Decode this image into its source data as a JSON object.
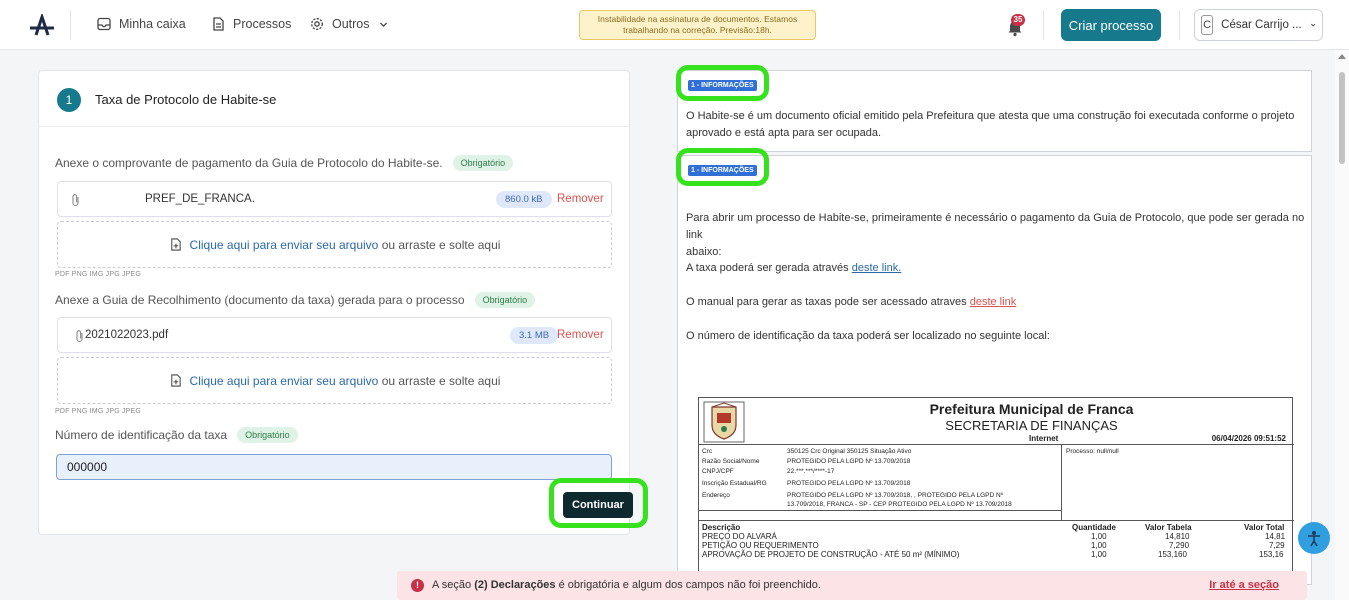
{
  "nav": {
    "inbox_label": "Minha caixa",
    "processes_label": "Processos",
    "others_label": "Outros",
    "notice": "Instabilidade na assinatura de documentos. Estamos trabalhando na correção. Previsão:18h.",
    "notification_count": "35",
    "create_button": "Criar processo",
    "user_initial": "C",
    "user_name": "César Carrijo ..."
  },
  "form": {
    "step_number": "1",
    "step_title": "Taxa de Protocolo de Habite-se",
    "required_badge": "Obrigatório",
    "field1_label": "Anexe o comprovante de pagamento da Guia de Protocolo do Habite-se.",
    "file1_name": "PREF_DE_FRANCA.",
    "file1_size": "860.0 kB",
    "remove_label": "Remover",
    "dropzone_link": "Clique aqui para enviar seu arquivo",
    "dropzone_rest": "ou arraste e solte aqui",
    "formats": "PDF PNG IMG JPG JPEG",
    "field2_label": "Anexe a Guia de Recolhimento (documento da taxa) gerada para o processo",
    "file2_name": "2021022023.pdf",
    "file2_size": "3.1 MB",
    "field3_label": "Número de identificação da taxa",
    "tax_id_value": "000000",
    "continue_button": "Continuar"
  },
  "info": {
    "tag": "1 - INFORMAÇÕES",
    "p1_line1": "O Habite-se é um documento oficial emitido pela Prefeitura que atesta que uma construção foi executada conforme o projeto",
    "p1_line2": "aprovado e está apta para ser ocupada.",
    "p2_line1": "Para abrir um processo de Habite-se, primeiramente é necessário o pagamento da Guia de Protocolo, que pode ser gerada no link",
    "p2_line2": "abaixo:",
    "p3_text": "A taxa poderá ser gerada através",
    "p3_link": "deste link.",
    "p4_text": "O manual para gerar as taxas pode ser acessado atraves",
    "p4_link": "deste link",
    "p5_text": "O número de identificação da taxa poderá ser localizado no seguinte local:"
  },
  "doc": {
    "title": "Prefeitura Municipal de Franca",
    "subtitle": "SECRETARIA DE FINANÇAS",
    "internet": "Internet",
    "datetime": "06/04/2026 09:51:52",
    "crc_label": "Crc",
    "crc_line": "350125   Crc Original   350125   Situação       Ativo",
    "razao_label": "Razão Social/Nome",
    "razao_value": "PROTEGIDO PELA LGPD Nº 13.709/2018",
    "cnpj_label": "CNPJ/CPF",
    "cnpj_value": "22.***.***/****-17",
    "ie_label": "Inscrição Estadual/RG",
    "ie_value": "PROTEGIDO PELA LGPD Nº 13.709/2018",
    "end_label": "Endereço",
    "end_line1": "PROTEGIDO PELA LGPD Nº 13.709/2018, , PROTEGIDO PELA LGPD Nº",
    "end_line2": "13.709/2018, FRANCA - SP - CEP PROTEGIDO PELA LGPD Nº 13.709/2018",
    "processo": "Processo:  null/null",
    "col_desc": "Descrição",
    "col_qtd": "Quantidade",
    "col_vt": "Valor Tabela",
    "col_total": "Valor Total",
    "items": [
      {
        "desc": "PREÇO DO ALVARÁ",
        "qtd": "1,00",
        "vt": "14,810",
        "total": "14,81"
      },
      {
        "desc": "PETIÇÃO OU REQUERIMENTO",
        "qtd": "1,00",
        "vt": "7,290",
        "total": "7,29"
      },
      {
        "desc": "APROVAÇÃO DE PROJETO DE CONSTRUÇÃO - ATÉ 50 m² (MÍNIMO)",
        "qtd": "1,00",
        "vt": "153,160",
        "total": "153,16"
      }
    ]
  },
  "alert": {
    "text_pre": "A seção ",
    "text_bold": "(2) Declarações",
    "text_post": " é obrigatória e algum dos campos não foi preenchido.",
    "link": "Ir até a seção"
  },
  "colors": {
    "primary": "#167a8c",
    "highlight": "#35e21d",
    "danger": "#c73046"
  }
}
